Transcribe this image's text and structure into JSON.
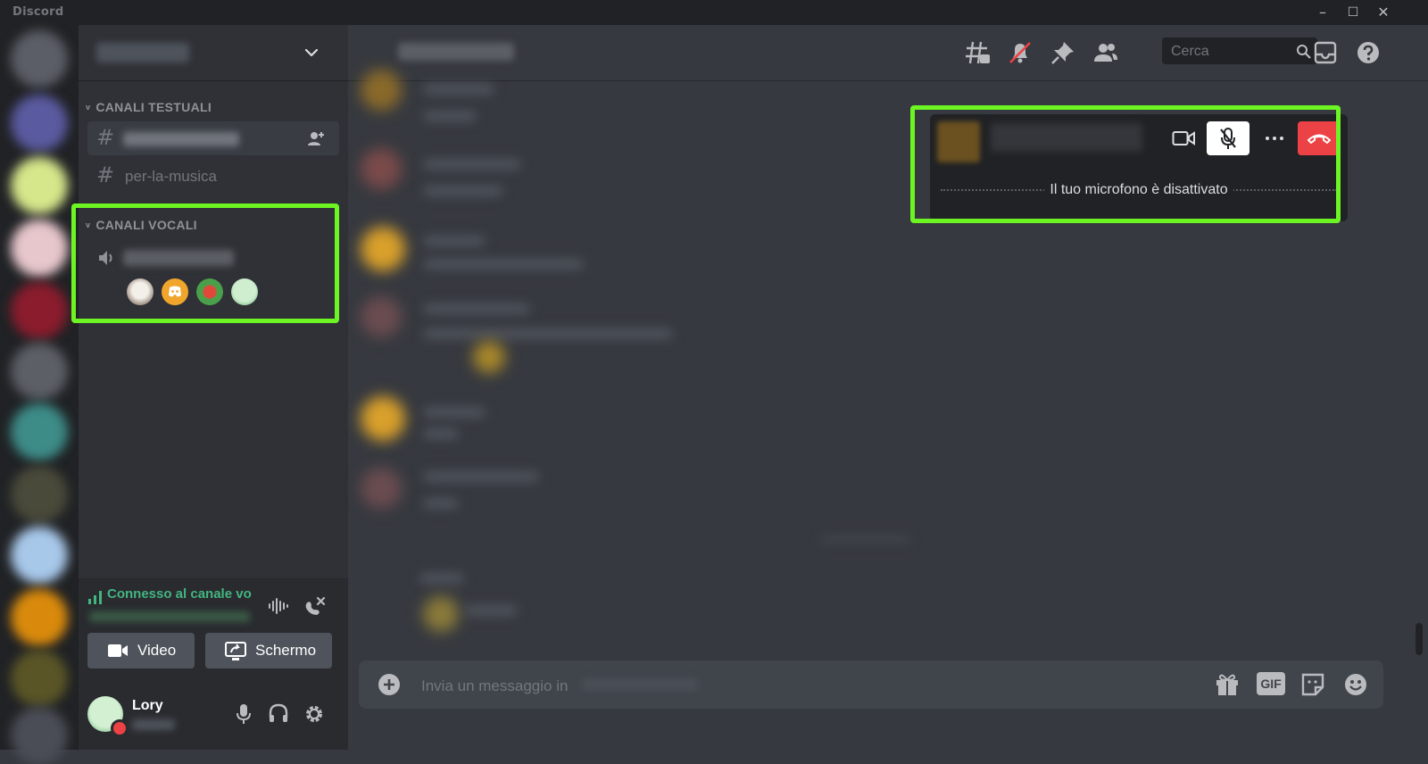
{
  "window": {
    "app_title": "Discord",
    "controls": {
      "minimize": "–",
      "maximize": "☐",
      "close": "✕"
    }
  },
  "sidebar": {
    "text_category": "CANALI TESTUALI",
    "voice_category": "CANALI VOCALI",
    "text_channels": [
      {
        "name": "",
        "icon": "hash-icon"
      },
      {
        "name": "per-la-musica",
        "icon": "hash-icon"
      }
    ],
    "voice_channel_icon": "speaker-icon"
  },
  "voice_panel": {
    "status": "Connesso al canale vo",
    "video_label": "Video",
    "screen_label": "Schermo"
  },
  "user": {
    "name": "Lory"
  },
  "header": {
    "search_placeholder": "Cerca"
  },
  "call": {
    "mic_status": "Il tuo microfono è disattivato"
  },
  "composer": {
    "placeholder": "Invia un messaggio in",
    "gif_label": "GIF"
  },
  "colors": {
    "highlight": "#6cf522",
    "connected": "#43b581",
    "hangup": "#ed4245",
    "background": "#36393f",
    "sidebar": "#2f3136",
    "rail": "#202225"
  }
}
